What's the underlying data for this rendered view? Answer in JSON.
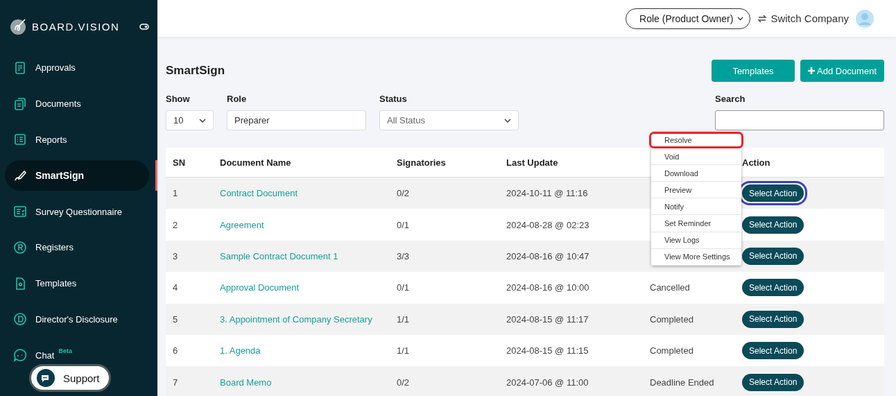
{
  "brand": {
    "name": "BOARD.VISION"
  },
  "sidebar": {
    "items": [
      {
        "label": "Approvals",
        "selected": false
      },
      {
        "label": "Documents",
        "selected": false
      },
      {
        "label": "Reports",
        "selected": false
      },
      {
        "label": "SmartSign",
        "selected": true
      },
      {
        "label": "Survey Questionnaire",
        "selected": false
      },
      {
        "label": "Registers",
        "selected": false
      },
      {
        "label": "Templates",
        "selected": false
      },
      {
        "label": "Director's Disclosure",
        "selected": false
      },
      {
        "label": "Chat",
        "selected": false,
        "badge": "Beta"
      }
    ]
  },
  "support": {
    "label": "Support"
  },
  "topbar": {
    "role_menu": "Role (Product Owner)",
    "switch_company": "Switch Company"
  },
  "page": {
    "title": "SmartSign",
    "buttons": [
      {
        "label": "Templates",
        "kind": "plain"
      },
      {
        "label": "Add Document",
        "kind": "add"
      }
    ]
  },
  "filters": {
    "show": {
      "label": "Show",
      "value": "10"
    },
    "role": {
      "label": "Role",
      "value": "Preparer"
    },
    "status": {
      "label": "Status",
      "value": "All Status"
    },
    "search": {
      "label": "Search"
    }
  },
  "table": {
    "columns": [
      "SN",
      "Document Name",
      "Signatories",
      "Last Update",
      "Action"
    ],
    "rows": [
      {
        "sn": "1",
        "document": "Contract Document",
        "signatories": "0/2",
        "last_update": "2024-10-11 @ 11:16",
        "action": "Select Action",
        "highlighted": true
      },
      {
        "sn": "2",
        "document": "Agreement",
        "signatories": "0/1",
        "last_update": "2024-08-28 @ 02:23",
        "action": "Select Action",
        "highlighted": false
      },
      {
        "sn": "3",
        "document": "Sample Contract Document 1",
        "signatories": "3/3",
        "last_update": "2024-08-16 @ 10:47",
        "action": "Select Action",
        "highlighted": false
      },
      {
        "sn": "4",
        "document": "Approval Document",
        "signatories": "0/1",
        "last_update": "2024-08-16 @ 10:00",
        "status": "Cancelled",
        "action": "Select Action",
        "highlighted": false
      },
      {
        "sn": "5",
        "document": "3. Appointment of Company Secretary",
        "signatories": "1/1",
        "last_update": "2024-08-15 @ 11:17",
        "status": "Completed",
        "action": "Select Action",
        "highlighted": false
      },
      {
        "sn": "6",
        "document": "1. Agenda",
        "signatories": "1/1",
        "last_update": "2024-08-15 @ 11:15",
        "status": "Completed",
        "action": "Select Action",
        "highlighted": false
      },
      {
        "sn": "7",
        "document": "Board Memo",
        "signatories": "0/2",
        "last_update": "2024-07-06 @ 11:00",
        "status": "Deadline Ended",
        "action": "Select Action",
        "highlighted": false
      }
    ]
  },
  "action_menu": {
    "items": [
      {
        "label": "Resolve",
        "highlighted": true
      },
      {
        "label": "Void",
        "highlighted": false
      },
      {
        "label": "Download",
        "highlighted": false
      },
      {
        "label": "Preview",
        "highlighted": false
      },
      {
        "label": "Notify",
        "highlighted": false
      },
      {
        "label": "Set Reminder",
        "highlighted": false
      },
      {
        "label": "View Logs",
        "highlighted": false
      },
      {
        "label": "View More Settings",
        "highlighted": false
      }
    ]
  }
}
